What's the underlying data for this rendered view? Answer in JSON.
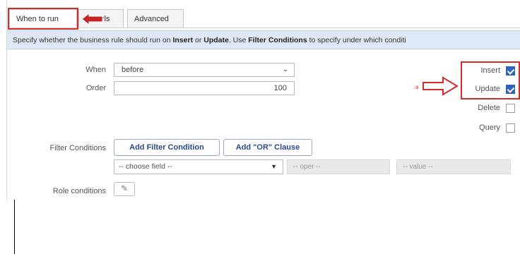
{
  "tabs": [
    {
      "label": "When to run",
      "active": true
    },
    {
      "label": "rls",
      "active": false
    },
    {
      "label": "Advanced",
      "active": false
    }
  ],
  "info": {
    "p1": "Specify whether the business rule should run on ",
    "b1": "Insert",
    "p2": " or ",
    "b2": "Update",
    "p3": ". Use ",
    "b3": "Filter Conditions",
    "p4": " to specify under which conditi"
  },
  "form": {
    "when_label": "When",
    "when_value": "before",
    "order_label": "Order",
    "order_value": "100",
    "filter_label": "Filter Conditions",
    "add_filter": "Add Filter Condition",
    "add_or": "Add \"OR\" Clause",
    "choose_field": "-- choose field --",
    "oper": "-- oper --",
    "value": "-- value --",
    "role_label": "Role conditions"
  },
  "checkboxes": [
    {
      "label": "Insert",
      "checked": true
    },
    {
      "label": "Update",
      "checked": true
    },
    {
      "label": "Delete",
      "checked": false
    },
    {
      "label": "Query",
      "checked": false
    }
  ],
  "annotation": {
    "marker": "a"
  },
  "colors": {
    "highlight": "#d42b2b",
    "accent": "#2f63b8",
    "info_bg": "#dfe9f5"
  }
}
